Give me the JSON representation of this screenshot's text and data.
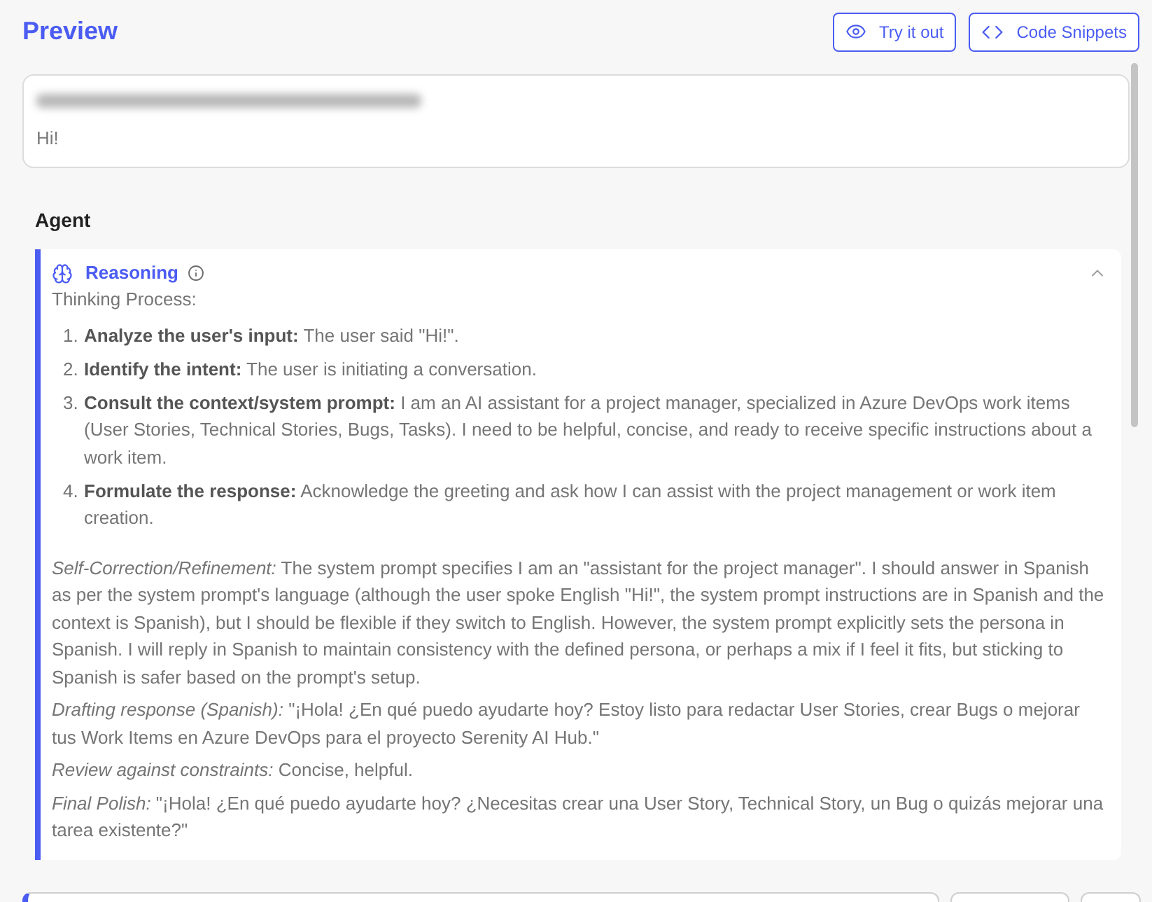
{
  "header": {
    "title": "Preview",
    "buttons": [
      {
        "label": "Try it out"
      },
      {
        "label": "Code Snippets"
      }
    ]
  },
  "user_message": {
    "text": "Hi!"
  },
  "agent": {
    "label": "Agent",
    "reasoning": {
      "title": "Reasoning",
      "expanded": true,
      "intro": "Thinking Process:",
      "steps": [
        {
          "number": "1.",
          "text": "**Analyze the user's input:** The user said \"Hi!\"."
        },
        {
          "number": "2.",
          "text": "**Identify the intent:** The user is initiating a conversation."
        },
        {
          "number": "3.",
          "text": "**Consult the context/system prompt:** I am an AI assistant for a project manager, specialized in Azure DevOps work items (User Stories, Technical Stories, Bugs, Tasks). I need to be helpful, concise, and ready to receive specific instructions about a work item."
        },
        {
          "number": "4.",
          "text": "**Formulate the response:** Acknowledge the greeting and ask how I can assist with the project management or work item creation."
        }
      ],
      "notes": [
        "*Self-Correction/Refinement:* The system prompt specifies I am an \"assistant for the project manager\". I should answer in Spanish as per the system prompt's language (although the user spoke English \"Hi!\", the system prompt instructions are in Spanish and the context is Spanish), but I should be flexible if they switch to English. However, the system prompt explicitly sets the persona in Spanish. I will reply in Spanish to maintain consistency with the defined persona, or perhaps a mix if I feel it fits, but sticking to Spanish is safer based on the prompt's setup.",
        "*Drafting response (Spanish):* \"¡Hola! ¿En qué puedo ayudarte hoy? Estoy listo para redactar User Stories, crear Bugs o mejorar tus Work Items en Azure DevOps para el proyecto Serenity AI Hub.\"",
        "*Review against constraints:* Concise, helpful.",
        "*Final Polish:* \"¡Hola! ¿En qué puedo ayudarte hoy? ¿Necesitas crear una User Story, Technical Story, un Bug o quizás mejorar una tarea existente?\""
      ]
    }
  }
}
